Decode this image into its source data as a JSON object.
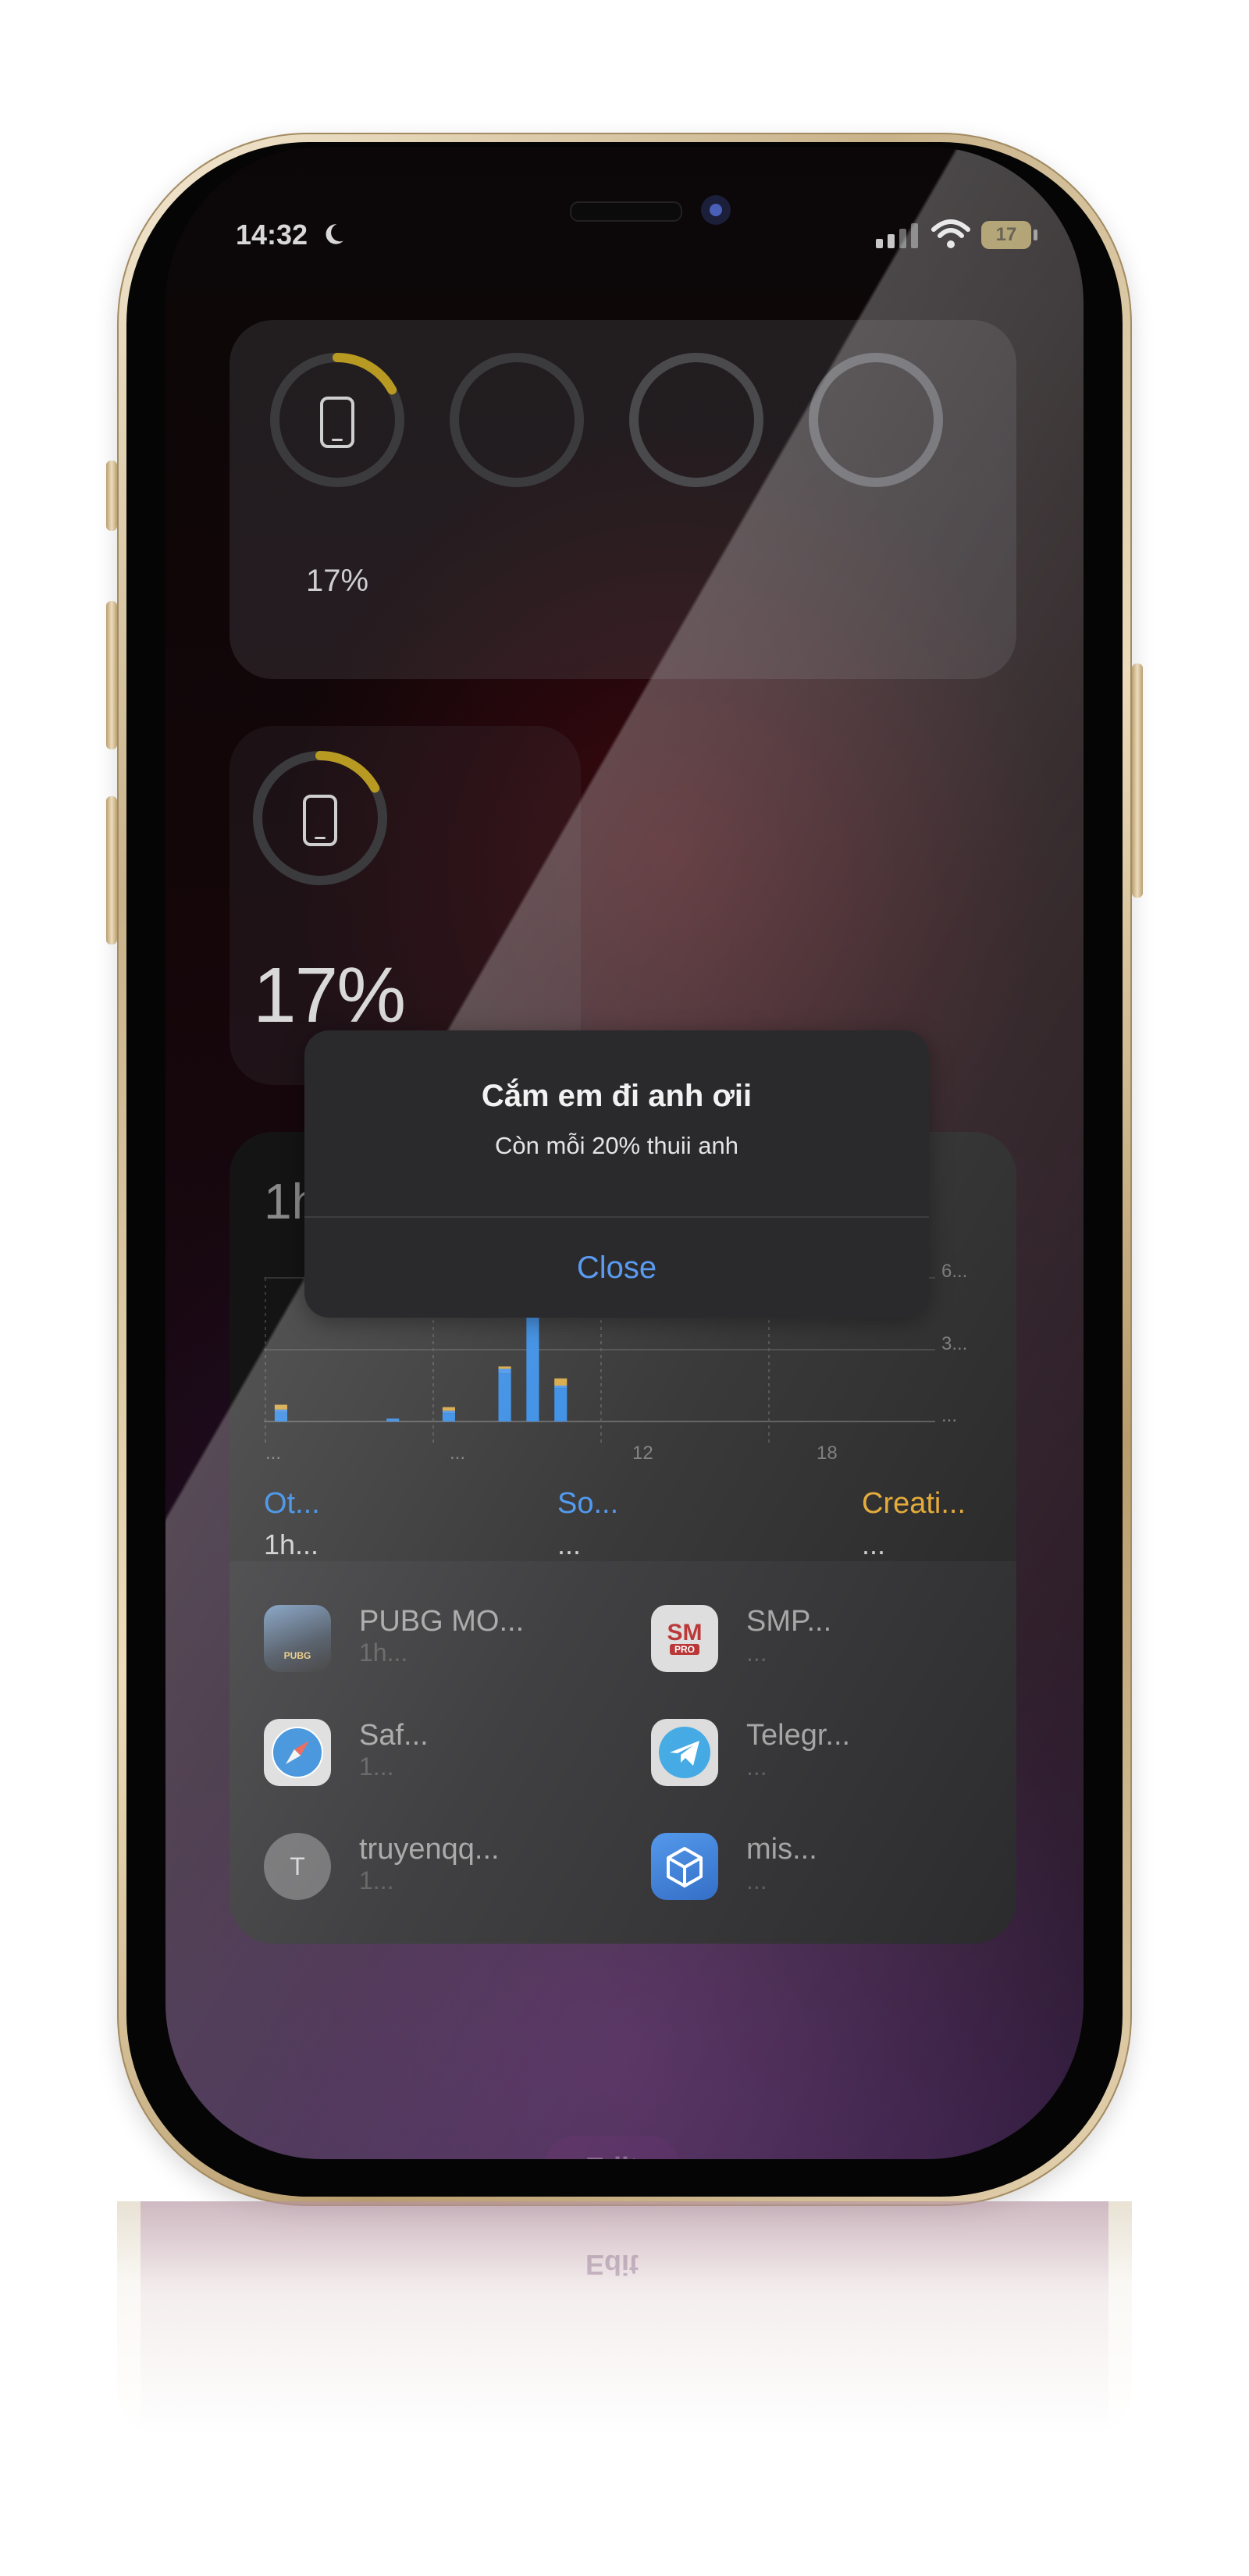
{
  "status_bar": {
    "time": "14:32",
    "battery": "17"
  },
  "batteries_widget": {
    "device_percent": "17%"
  },
  "single_battery_widget": {
    "percent": "17%"
  },
  "screen_time": {
    "total": "1h",
    "y_ticks": [
      "6...",
      "3...",
      "..."
    ],
    "x_ticks": [
      "...",
      "...",
      "12",
      "18"
    ],
    "categories": [
      {
        "name": "Ot...",
        "value": "1h...",
        "color": "#1a7ae0"
      },
      {
        "name": "So...",
        "value": "...",
        "color": "#2f86ea"
      },
      {
        "name": "Creati...",
        "value": "...",
        "color": "#e0a020"
      }
    ],
    "apps": [
      {
        "name": "PUBG MO...",
        "time": "1h..."
      },
      {
        "name": "SMP...",
        "time": "..."
      },
      {
        "name": "Saf...",
        "time": "1..."
      },
      {
        "name": "Telegr...",
        "time": "..."
      },
      {
        "name": "truyenqq...",
        "time": "1...",
        "avatar_letter": "T"
      },
      {
        "name": "mis...",
        "time": "..."
      }
    ],
    "sm_icon_text": "SM",
    "sm_icon_sub": "PRO",
    "pubg_icon_text": "PUBG"
  },
  "chart_data": {
    "type": "bar",
    "y_ticks": [
      "6...",
      "3...",
      "..."
    ],
    "x_ticks": [
      "...",
      "...",
      "12",
      "18"
    ],
    "series": [
      {
        "name": "Ot...",
        "color": "#1a7ae0",
        "values": [
          0.4,
          0,
          0,
          0,
          0.12,
          0,
          0.35,
          0,
          2.0,
          5.0,
          1.4,
          0,
          0,
          0,
          0,
          0,
          0,
          0,
          0,
          0,
          0,
          0,
          0,
          0
        ]
      },
      {
        "name": "So...",
        "color": "#2f86ea",
        "values": [
          0.1,
          0,
          0,
          0,
          0,
          0,
          0.1,
          0,
          0.2,
          0.3,
          0.1,
          0,
          0,
          0,
          0,
          0,
          0,
          0,
          0,
          0,
          0,
          0,
          0,
          0
        ]
      },
      {
        "name": "Creati...",
        "color": "#d09a2a",
        "values": [
          0.2,
          0,
          0,
          0,
          0,
          0,
          0.15,
          0,
          0.1,
          0.1,
          0.3,
          0,
          0,
          0,
          0,
          0,
          0,
          0,
          0,
          0,
          0,
          0,
          0,
          0
        ]
      }
    ],
    "ylim": [
      0,
      6
    ]
  },
  "alert": {
    "title": "Cắm em đi anh ơii",
    "message": "Còn mỗi 20% thuii anh",
    "button": "Close"
  },
  "edit_button": "Edit",
  "colors": {
    "accent_blue": "#5a9bf0",
    "ring_yellow": "#b89a22"
  }
}
